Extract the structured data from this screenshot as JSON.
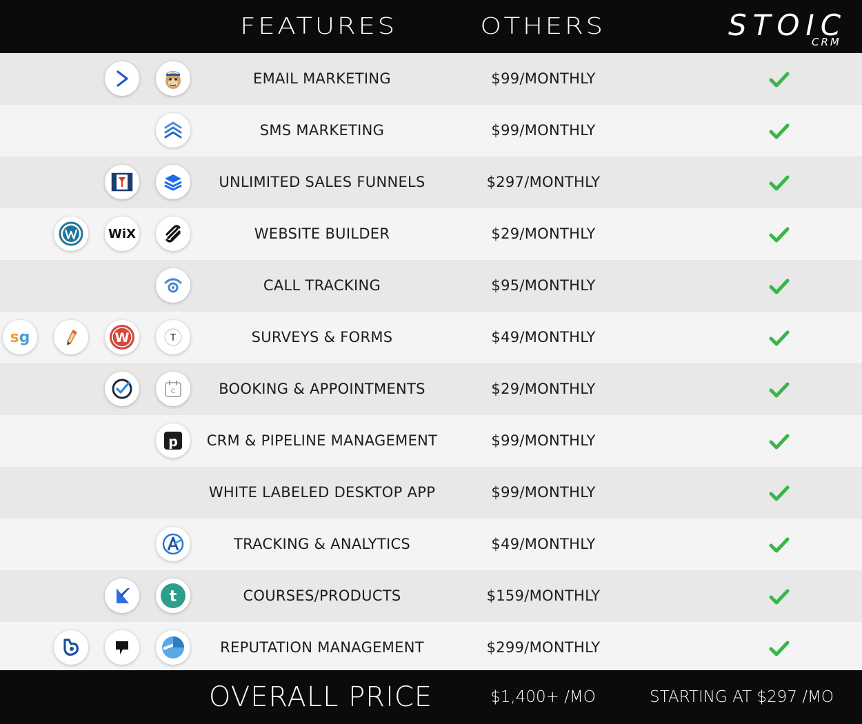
{
  "header": {
    "features_label": "FEATURES",
    "others_label": "OTHERS",
    "brand": "STOIC",
    "brand_sub": "CRM"
  },
  "colors": {
    "header_bg": "#0b0b0b",
    "row_odd": "#e8e8e8",
    "row_even": "#f4f4f4",
    "check_green": "#3bb54a"
  },
  "rows": [
    {
      "feature": "EMAIL MARKETING",
      "price": "$99/MONTHLY",
      "included": true,
      "logos": [
        "activecampaign-icon",
        "mailchimp-icon"
      ]
    },
    {
      "feature": "SMS MARKETING",
      "price": "$99/MONTHLY",
      "included": true,
      "logos": [
        "sms-chevrons-icon"
      ]
    },
    {
      "feature": "UNLIMITED SALES FUNNELS",
      "price": "$297/MONTHLY",
      "included": true,
      "logos": [
        "clickfunnels-icon",
        "layers-icon"
      ]
    },
    {
      "feature": "WEBSITE BUILDER",
      "price": "$29/MONTHLY",
      "included": true,
      "logos": [
        "wordpress-icon",
        "wix-icon",
        "squarespace-icon"
      ]
    },
    {
      "feature": "CALL TRACKING",
      "price": "$95/MONTHLY",
      "included": true,
      "logos": [
        "calltracking-icon"
      ]
    },
    {
      "feature": "SURVEYS & FORMS",
      "price": "$49/MONTHLY",
      "included": true,
      "logos": [
        "surveygizmo-icon",
        "pencil-icon",
        "wufoo-icon",
        "typeform-icon"
      ]
    },
    {
      "feature": "BOOKING & APPOINTMENTS",
      "price": "$29/MONTHLY",
      "included": true,
      "logos": [
        "acuity-check-icon",
        "calendly-icon"
      ]
    },
    {
      "feature": "CRM & PIPELINE MANAGEMENT",
      "price": "$99/MONTHLY",
      "included": true,
      "logos": [
        "pipedrive-icon"
      ]
    },
    {
      "feature": "WHITE LABELED DESKTOP APP",
      "price": "$99/MONTHLY",
      "included": true,
      "logos": []
    },
    {
      "feature": "TRACKING & ANALYTICS",
      "price": "$49/MONTHLY",
      "included": true,
      "logos": [
        "analytics-a-icon"
      ]
    },
    {
      "feature": "COURSES/PRODUCTS",
      "price": "$159/MONTHLY",
      "included": true,
      "logos": [
        "kajabi-icon",
        "teachable-icon"
      ]
    },
    {
      "feature": "REPUTATION MANAGEMENT",
      "price": "$299/MONTHLY",
      "included": true,
      "logos": [
        "birdeye-icon",
        "podium-icon",
        "reputation-icon"
      ]
    }
  ],
  "footer": {
    "label": "OVERALL PRICE",
    "others_total": "$1,400+ /MO",
    "stoic_total": "STARTING AT $297 /MO"
  }
}
